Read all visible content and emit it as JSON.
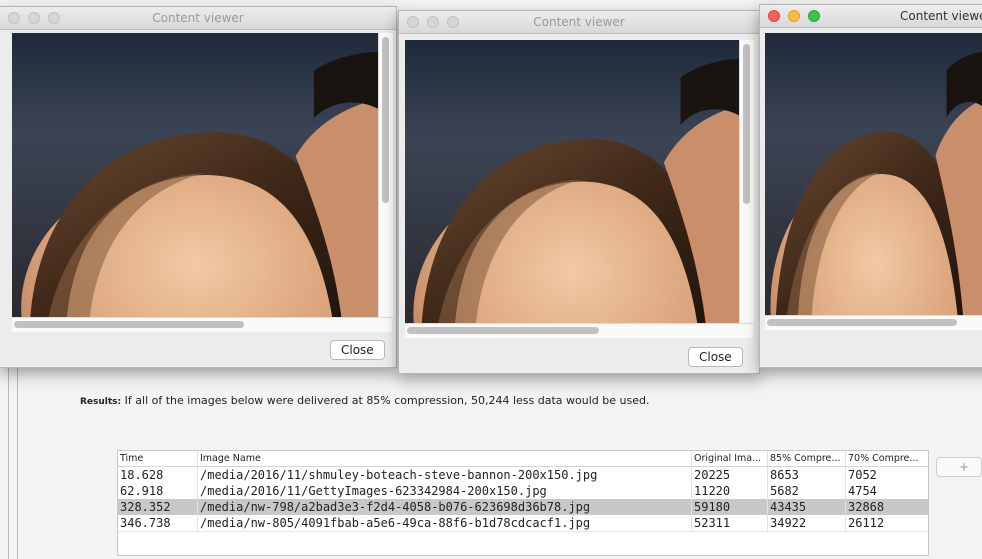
{
  "windows": [
    {
      "title": "Content viewer",
      "close_label": "Close"
    },
    {
      "title": "Content viewer",
      "close_label": "Close"
    },
    {
      "title": "Content viewer"
    }
  ],
  "results": {
    "label": "Results:",
    "text": "If all of the images below were delivered at 85% compression, 50,244 less data would be used."
  },
  "table": {
    "headers": [
      "Time",
      "Image Name",
      "Original Ima...",
      "85% Compre...",
      "70% Compre..."
    ],
    "rows": [
      [
        "18.628",
        "/media/2016/11/shmuley-boteach-steve-bannon-200x150.jpg",
        "20225",
        "8653",
        "7052"
      ],
      [
        "62.918",
        "/media/2016/11/GettyImages-623342984-200x150.jpg",
        "11220",
        "5682",
        "4754"
      ],
      [
        "328.352",
        "/media/nw-798/a2bad3e3-f2d4-4058-b076-623698d36b78.jpg",
        "59180",
        "43435",
        "32868"
      ],
      [
        "346.738",
        "/media/nw-805/4091fbab-a5e6-49ca-88f6-b1d78cdcacf1.jpg",
        "52311",
        "34922",
        "26112"
      ]
    ],
    "selected_row": 2
  },
  "plus_label": "+"
}
